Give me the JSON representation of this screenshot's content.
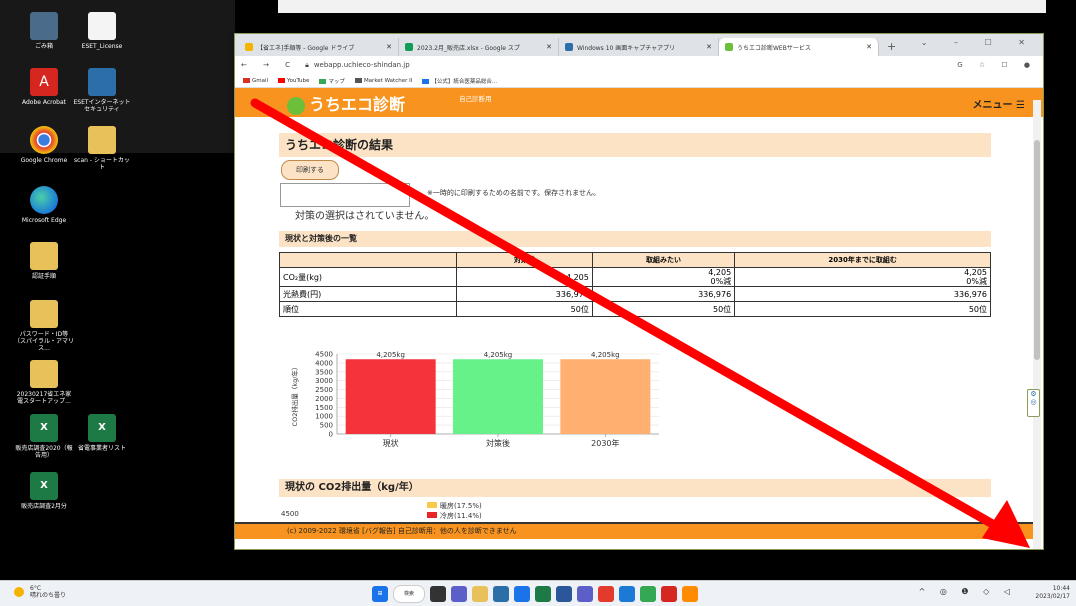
{
  "desktop": {
    "icons": [
      {
        "label": "ごみ箱",
        "kind": "recycle"
      },
      {
        "label": "ESET_License",
        "kind": "doc"
      },
      {
        "label": "Adobe Acrobat",
        "kind": "pdf"
      },
      {
        "label": "ESETインターネットセキュリティ",
        "kind": "eset"
      },
      {
        "label": "Google Chrome",
        "kind": "chrome"
      },
      {
        "label": "scan - ショートカット",
        "kind": "folder"
      },
      {
        "label": "Microsoft Edge",
        "kind": "edge"
      },
      {
        "label": "認証手順",
        "kind": "folder"
      },
      {
        "label": "パスワード・ID等（スパイラル・アマリス...",
        "kind": "folder"
      },
      {
        "label": "20230217省エネ家電スタートアップ...",
        "kind": "folder"
      },
      {
        "label": "販売店調査2020（報告用）",
        "kind": "excel"
      },
      {
        "label": "省電事業者リスト",
        "kind": "excel"
      },
      {
        "label": "販売店調査2月分",
        "kind": "excel"
      }
    ]
  },
  "browser": {
    "tabs": [
      {
        "title": "【省エネ]手順等 - Google ドライブ",
        "color": "#f4b400"
      },
      {
        "title": "2023.2月_販売店.xlsx - Google スプ",
        "color": "#0f9d58"
      },
      {
        "title": "Windows 10 画面キャプチャアプリ",
        "color": "#2b6ea8"
      },
      {
        "title": "うちエコ診断WEBサービス",
        "color": "#6bbf3b"
      }
    ],
    "new_tab": "+",
    "window_controls": "⌄ – ☐ ✕",
    "nav": "← → C",
    "url": "webapp.uchieco-shindan.jp",
    "addr_right": "G ☆ ☐ ●",
    "bookmarks": [
      {
        "label": "Gmail",
        "color": "#d93025"
      },
      {
        "label": "YouTube",
        "color": "#ff0000"
      },
      {
        "label": "マップ",
        "color": "#34a853"
      },
      {
        "label": "Market Watcher II",
        "color": "#555555"
      },
      {
        "label": "【公式】統合医薬品総合...",
        "color": "#1a73e8"
      }
    ]
  },
  "site": {
    "logo": "うちエコ診断",
    "subtitle": "自己診断用",
    "menu": "メニュー ☰",
    "result_title": "うちエコ診断の結果",
    "print_button": "印刷する",
    "name_placeholder": "",
    "print_note": "※一時的に印刷するための名前です。保存されません。",
    "no_selection": "対策の選択はされていません。",
    "summary_title": "現状と対策後の一覧",
    "table": {
      "headers": [
        "",
        "対策前",
        "取組みたい",
        "2030年までに取組む"
      ],
      "rows": [
        {
          "label": "CO₂量(kg)",
          "c1": "4,205",
          "c2": "4,205",
          "c2b": "0%減",
          "c3": "4,205",
          "c3b": "0%減"
        },
        {
          "label": "光熱費(円)",
          "c1": "336,976",
          "c2": "336,976",
          "c2b": "",
          "c3": "336,976",
          "c3b": ""
        },
        {
          "label": "順位",
          "c1": "50位",
          "c2": "50位",
          "c2b": "",
          "c3": "50位",
          "c3b": ""
        }
      ]
    },
    "pie_section_title": "現状の CO2排出量（kg/年）",
    "pie_legend": [
      {
        "label": "暖房(17.5%)",
        "color": "#f9c94d"
      },
      {
        "label": "冷房(11.4%)",
        "color": "#e8262a"
      }
    ],
    "pie_ytick": "4500",
    "footer": "(c) 2009-2022 環境省 [バグ報告] 自己診断用：他の人を診断できません"
  },
  "chart_data": {
    "type": "bar",
    "categories": [
      "現状",
      "対策後",
      "2030年"
    ],
    "values": [
      4205,
      4205,
      4205
    ],
    "data_labels": [
      "4,205kg",
      "4,205kg",
      "4,205kg"
    ],
    "colors": [
      "#f5333a",
      "#66f288",
      "#ffb070"
    ],
    "ylabel": "CO2排出量（kg/年）",
    "ylim": [
      0,
      4500
    ],
    "yticks": [
      0,
      500,
      1000,
      1500,
      2000,
      2500,
      3000,
      3500,
      4000,
      4500
    ],
    "grid": true
  },
  "taskbar": {
    "weather_temp": "6°C",
    "weather_desc": "晴れのち曇り",
    "search": "検索",
    "apps": [
      {
        "name": "start",
        "color": "#1a73e8"
      },
      {
        "name": "task-view",
        "color": "#333333"
      },
      {
        "name": "chat",
        "color": "#5b5fc7"
      },
      {
        "name": "explorer",
        "color": "#e9c15a"
      },
      {
        "name": "store",
        "color": "#2b6ea8"
      },
      {
        "name": "mail",
        "color": "#1a73e8"
      },
      {
        "name": "excel",
        "color": "#1e7a45"
      },
      {
        "name": "word",
        "color": "#2b579a"
      },
      {
        "name": "teams",
        "color": "#5b5fc7"
      },
      {
        "name": "chrome",
        "color": "#e23b2e"
      },
      {
        "name": "edge",
        "color": "#1b7ad6"
      },
      {
        "name": "photos",
        "color": "#34a853"
      },
      {
        "name": "acrobat",
        "color": "#d5261f"
      },
      {
        "name": "snip",
        "color": "#ff8c00"
      }
    ],
    "tray": "^ ◎ ❶ ◇ ◁",
    "time": "10:44",
    "date": "2023/02/17"
  },
  "overlay": {
    "arrow_color": "#ff0000"
  }
}
